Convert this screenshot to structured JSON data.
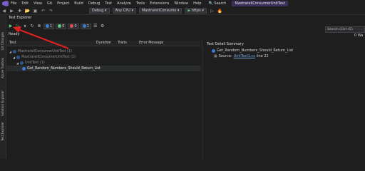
{
  "menu": {
    "items": [
      "File",
      "Edit",
      "View",
      "Git",
      "Project",
      "Build",
      "Debug",
      "Test",
      "Analyze",
      "Tools",
      "Extensions",
      "Window",
      "Help"
    ],
    "search_label": "Search",
    "window_title": "MastrareliConsumerUnitTest"
  },
  "toolbar": {
    "config": "Debug",
    "platform": "Any CPU",
    "startup_project": "MastrareliConsume",
    "run_target": "https"
  },
  "left_tabs": [
    "Git Changes",
    "Azure Toolbox",
    "Solution Explorer",
    "Test Explorer"
  ],
  "test_explorer": {
    "title": "Test Explorer",
    "badges": [
      {
        "count": "1",
        "color": "#3a7bd5",
        "name": "total"
      },
      {
        "count": "0",
        "color": "#5ecb7e",
        "name": "passed"
      },
      {
        "count": "0",
        "color": "#e05252",
        "name": "failed"
      },
      {
        "count": "1",
        "color": "#3a7bd5",
        "name": "not-run"
      }
    ],
    "status": "Ready",
    "search_placeholder": "Search (Ctrl+E)",
    "columns": [
      "Test",
      "Duration",
      "Traits",
      "Error Message"
    ],
    "rows": [
      {
        "label": "MastrareliConsumerUnitTest (1)",
        "level": 0
      },
      {
        "label": "MastrareliConsumerUnitTest (1)",
        "level": 1
      },
      {
        "label": "UnitTest (1)",
        "level": 2
      },
      {
        "label": "Get_Random_Numbers_Should_Return_List",
        "level": 3
      }
    ]
  },
  "detail": {
    "title": "Test Detail Summary",
    "test_name": "Get_Random_Numbers_Should_Return_List",
    "source_label": "Source:",
    "source_file": "UnitTest1.cs",
    "source_line": "line 22",
    "right_label": "0 Wa"
  },
  "colors": {
    "accent": "#3a7bd5",
    "arrow": "#e02020",
    "play": "#5ecb7e"
  }
}
